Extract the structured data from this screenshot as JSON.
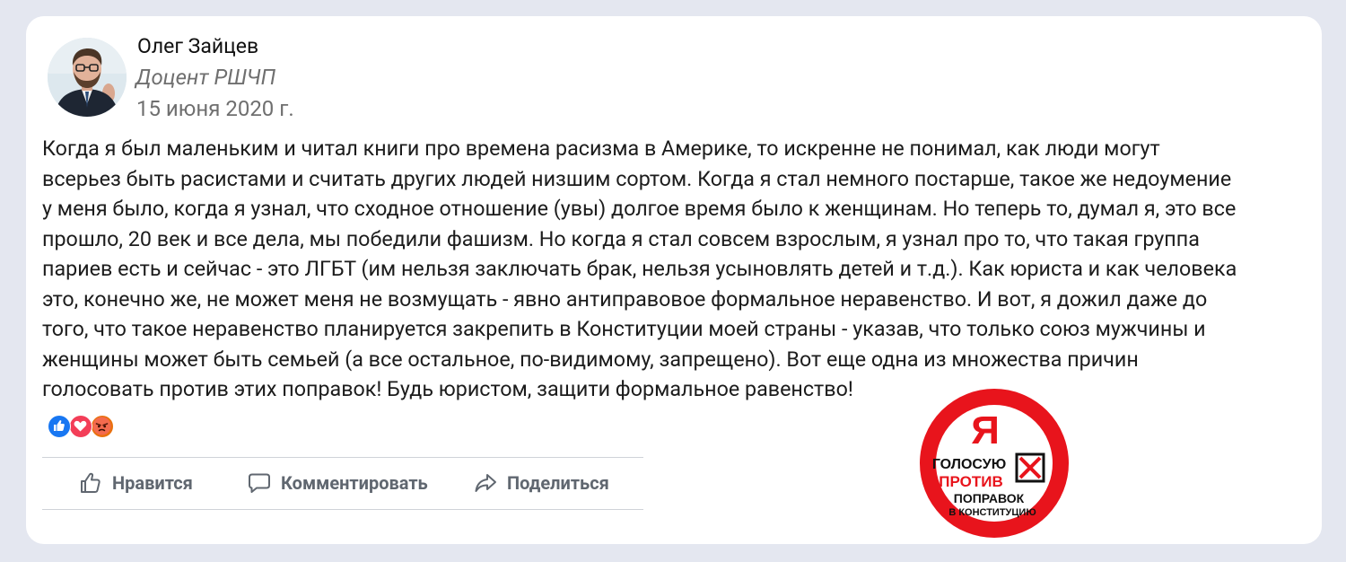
{
  "author": {
    "name": "Олег Зайцев",
    "position": "Доцент РШЧП",
    "date": "15 июня 2020 г."
  },
  "post": {
    "lines": [
      "Когда я был маленьким и читал книги про времена расизма в Америке, то искренне не понимал, как люди могут",
      "всерьез быть расистами и считать других людей низшим сортом. Когда я стал немного постарше, такое же недоумение",
      "у меня было, когда я узнал, что сходное отношение (увы) долгое время было к женщинам. Но теперь то, думал я, это все",
      "прошло, 20 век и все дела, мы победили фашизм. Но когда я стал совсем взрослым, я узнал про то, что такая группа",
      "париев есть и сейчас - это ЛГБТ (им нельзя заключать брак, нельзя усыновлять детей и т.д.). Как юриста и как человека",
      "это, конечно же, не может меня не возмущать - явно антиправовое формальное неравенство. И вот, я дожил даже до",
      "того, что такое неравенство планируется закрепить в Конституции моей страны - указав, что только союз мужчины и",
      "женщины может быть семьей (а все остальное, по-видимому, запрещено). Вот еще одна из множества причин",
      "голосовать против этих поправок! Будь юристом, защити формальное равенство!"
    ]
  },
  "reactions": [
    {
      "icon": "like-reaction-icon",
      "color": "#1877f2"
    },
    {
      "icon": "love-reaction-icon",
      "color": "#f33e58"
    },
    {
      "icon": "angry-reaction-icon",
      "color": "#e9710f"
    }
  ],
  "actions": {
    "like_label": "Нравится",
    "comment_label": "Комментировать",
    "share_label": "Поделиться"
  },
  "badge": {
    "big_letter": "Я",
    "line1": "ГОЛОСУЮ",
    "line2": "ПРОТИВ",
    "line3": "ПОПРАВОК",
    "line4": "В КОНСТИТУЦИЮ",
    "accent_color": "#e8141c"
  },
  "colors": {
    "page_background": "#e4e7f0",
    "card_background": "#ffffff",
    "secondary_text": "#6f6f6f",
    "action_text": "#606770"
  }
}
